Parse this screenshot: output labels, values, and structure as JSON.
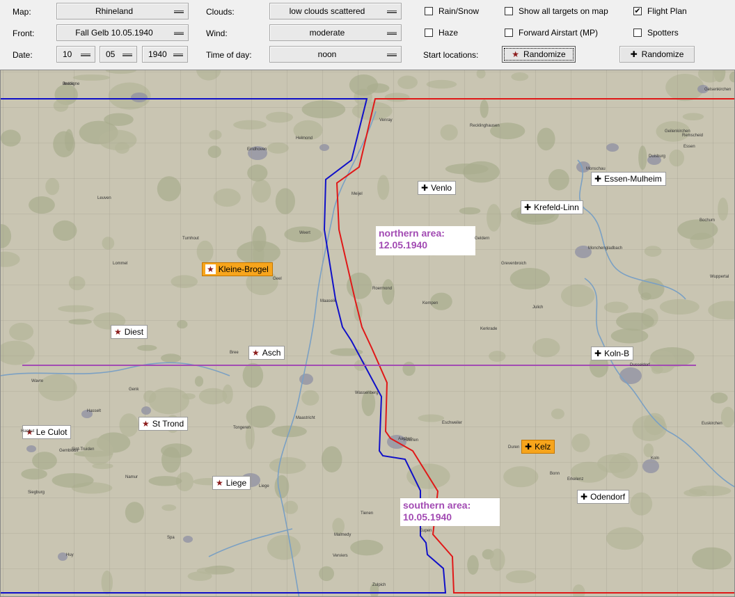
{
  "toolbar": {
    "map_label": "Map:",
    "map_value": "Rhineland",
    "front_label": "Front:",
    "front_value": "Fall Gelb 10.05.1940",
    "date_label": "Date:",
    "date_day": "10",
    "date_month": "05",
    "date_year": "1940",
    "clouds_label": "Clouds:",
    "clouds_value": "low clouds scattered",
    "wind_label": "Wind:",
    "wind_value": "moderate",
    "time_label": "Time of day:",
    "time_value": "noon",
    "rain_label": "Rain/Snow",
    "haze_label": "Haze",
    "start_locations_label": "Start locations:",
    "show_targets_label": "Show all targets on map",
    "forward_airstart_label": "Forward Airstart (MP)",
    "flight_plan_label": "Flight Plan",
    "spotters_label": "Spotters",
    "randomize_axis_label": "Randomize",
    "randomize_allied_label": "Randomize",
    "check_mark": "✔"
  },
  "map": {
    "area_north_line1": "northern area:",
    "area_north_line2": "12.05.1940",
    "area_south_line1": "southern area:",
    "area_south_line2": "10.05.1940",
    "towns": [
      "Breda",
      "Eindhoven",
      "Helmond",
      "Venray",
      "Meijel",
      "Weert",
      "Roermond",
      "Maaseik",
      "Geilenkirchen",
      "Maastricht",
      "Tongeren",
      "Liege",
      "Aachen",
      "Eschweiler",
      "Duren",
      "Julich",
      "Grevenbroich",
      "Monchengladbach",
      "Dusseldorf",
      "Koln",
      "Bonn",
      "Zulpich",
      "Malmedy",
      "Verviers",
      "Spa",
      "Huy",
      "Namur",
      "Hannut",
      "Wavre",
      "Leuven",
      "Turnhout",
      "Lommel",
      "Geel",
      "Bree",
      "Genk",
      "Hasselt",
      "Sint-Truiden",
      "Tienen",
      "Eupen",
      "Monschau",
      "Duisburg",
      "Essen",
      "Bochum",
      "Wuppertal",
      "Remscheid",
      "Gelsenkirchen",
      "Recklinghausen",
      "Geldern",
      "Kempen",
      "Wassenberg",
      "Heerlen",
      "Kerkrade",
      "Erkelenz",
      "Euskirchen",
      "Siegburg",
      "Gembloux",
      "Jodoigne"
    ],
    "axis_bases": [
      {
        "name": "Kleine-Brogel",
        "selected": true
      },
      {
        "name": "Diest",
        "selected": false
      },
      {
        "name": "Asch",
        "selected": false
      },
      {
        "name": "St Trond",
        "selected": false
      },
      {
        "name": "Le Culot",
        "selected": false
      },
      {
        "name": "Liege",
        "selected": false
      }
    ],
    "german_bases": [
      {
        "name": "Venlo",
        "selected": false
      },
      {
        "name": "Krefeld-Linn",
        "selected": false
      },
      {
        "name": "Essen-Mulheim",
        "selected": false
      },
      {
        "name": "Koln-B",
        "selected": false
      },
      {
        "name": "Kelz",
        "selected": true
      },
      {
        "name": "Odendorf",
        "selected": false
      }
    ],
    "colors": {
      "allied_line": "#1010c8",
      "german_line": "#e01818",
      "divider_line": "#a24bb3",
      "selected_marker": "#f7a51c",
      "map_base": "#c9c5b2"
    },
    "icons": {
      "axis_marker": "star-icon",
      "german_marker": "cross-icon"
    }
  }
}
